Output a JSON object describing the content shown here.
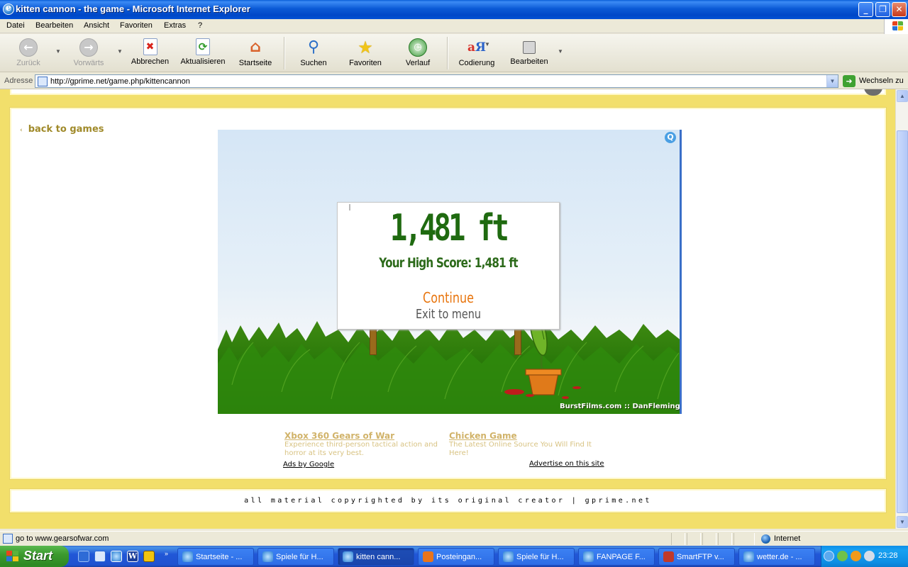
{
  "window": {
    "title": "kitten cannon - the game - Microsoft Internet Explorer"
  },
  "menu": [
    "Datei",
    "Bearbeiten",
    "Ansicht",
    "Favoriten",
    "Extras",
    "?"
  ],
  "toolbar": {
    "back": "Zurück",
    "forward": "Vorwärts",
    "stop": "Abbrechen",
    "refresh": "Aktualisieren",
    "home": "Startseite",
    "search": "Suchen",
    "favorites": "Favoriten",
    "history": "Verlauf",
    "encoding": "Codierung",
    "edit": "Bearbeiten"
  },
  "address": {
    "label": "Adresse",
    "url": "http://gprime.net/game.php/kittencannon",
    "go": "Wechseln zu"
  },
  "page": {
    "back_link": "back to games",
    "game": {
      "score": "1,481 ft",
      "high_score": "Your High Score: 1,481 ft",
      "continue": "Continue",
      "exit": "Exit to menu",
      "credit": "BurstFilms.com :: DanFleming.net",
      "q_icon": "Q"
    },
    "ads": [
      {
        "title": "Xbox 360 Gears of War",
        "desc": "Experience third-person tactical action and horror at its very best."
      },
      {
        "title": "Chicken Game",
        "desc": "The Latest Online Source You Will Find It Here!"
      }
    ],
    "ads_by": "Ads by Google",
    "advertise": "Advertise on this site",
    "footer": "all material copyrighted by its original creator | gprime.net"
  },
  "status": {
    "text": "go to www.gearsofwar.com",
    "zone": "Internet"
  },
  "taskbar": {
    "start": "Start",
    "tasks": [
      "Startseite - ...",
      "Spiele für H...",
      "kitten cann...",
      "Posteingan...",
      "Spiele für H...",
      "FANPAGE F...",
      "SmartFTP v...",
      "wetter.de - ..."
    ],
    "clock": "23:28"
  },
  "colors": {
    "page_bg": "#f2df6b",
    "link": "#a08a2a",
    "score_green": "#1f6a10",
    "continue_orange": "#e8750e",
    "ad_gold": "#d1b36a"
  }
}
